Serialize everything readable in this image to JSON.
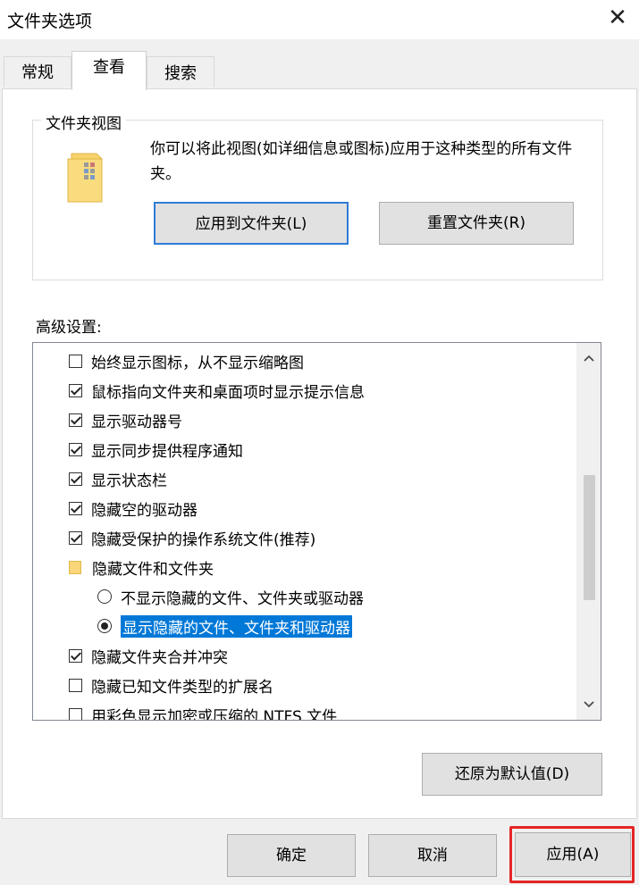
{
  "window": {
    "title": "文件夹选项"
  },
  "tabs": [
    {
      "label": "常规"
    },
    {
      "label": "查看"
    },
    {
      "label": "搜索"
    }
  ],
  "folder_views": {
    "legend": "文件夹视图",
    "description": "你可以将此视图(如详细信息或图标)应用于这种类型的所有文件夹。",
    "apply_button": "应用到文件夹(L)",
    "reset_button": "重置文件夹(R)"
  },
  "advanced": {
    "label": "高级设置:",
    "items": [
      {
        "type": "checkbox",
        "checked": false,
        "label": "始终显示图标，从不显示缩略图"
      },
      {
        "type": "checkbox",
        "checked": true,
        "label": "鼠标指向文件夹和桌面项时显示提示信息"
      },
      {
        "type": "checkbox",
        "checked": true,
        "label": "显示驱动器号"
      },
      {
        "type": "checkbox",
        "checked": true,
        "label": "显示同步提供程序通知"
      },
      {
        "type": "checkbox",
        "checked": true,
        "label": "显示状态栏"
      },
      {
        "type": "checkbox",
        "checked": true,
        "label": "隐藏空的驱动器"
      },
      {
        "type": "checkbox",
        "checked": true,
        "label": "隐藏受保护的操作系统文件(推荐)"
      },
      {
        "type": "folder",
        "label": "隐藏文件和文件夹"
      },
      {
        "type": "radio",
        "checked": false,
        "label": "不显示隐藏的文件、文件夹或驱动器"
      },
      {
        "type": "radio",
        "checked": true,
        "selected": true,
        "label": "显示隐藏的文件、文件夹和驱动器"
      },
      {
        "type": "checkbox",
        "checked": true,
        "label": "隐藏文件夹合并冲突"
      },
      {
        "type": "checkbox",
        "checked": false,
        "label": "隐藏已知文件类型的扩展名"
      },
      {
        "type": "checkbox",
        "checked": false,
        "label": "用彩色显示加密或压缩的 NTFS 文件"
      }
    ]
  },
  "restore_button": "还原为默认值(D)",
  "footer": {
    "ok": "确定",
    "cancel": "取消",
    "apply": "应用(A)"
  },
  "colors": {
    "selection": "#0078d7",
    "highlight_box": "#e52525",
    "focus_border": "#2f7bd8"
  }
}
